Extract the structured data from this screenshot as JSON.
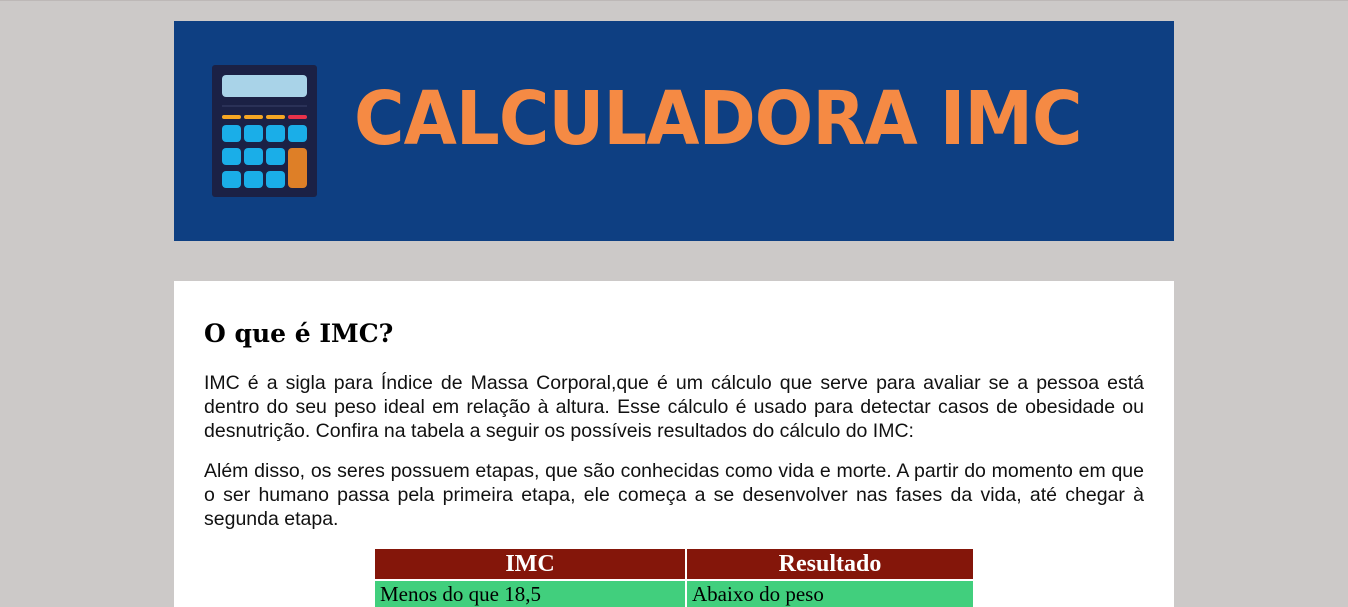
{
  "header": {
    "title": "CALCULADORA IMC",
    "icon": "calculator-icon",
    "colors": {
      "banner_bg": "#0e3f82",
      "title": "#f58a44"
    }
  },
  "main": {
    "heading": "O que é IMC?",
    "paragraphs": [
      "IMC é a sigla para Índice de Massa Corporal,que é um cálculo que serve para avaliar se a pessoa está dentro do seu peso ideal em relação à altura. Esse cálculo é usado para detectar casos de obesidade ou desnutrição. Confira na tabela a seguir os possíveis resultados do cálculo do IMC:",
      "Além disso, os seres possuem etapas, que são conhecidas como vida e morte. A partir do momento em que o ser humano passa pela primeira etapa, ele começa a se desenvolver nas fases da vida, até chegar à segunda etapa."
    ],
    "table": {
      "headers": [
        "IMC",
        "Resultado"
      ],
      "rows": [
        [
          "Menos do que 18,5",
          "Abaixo do peso"
        ]
      ],
      "colors": {
        "header_bg": "#84160a",
        "row_bg": "#41cf7d"
      }
    }
  }
}
